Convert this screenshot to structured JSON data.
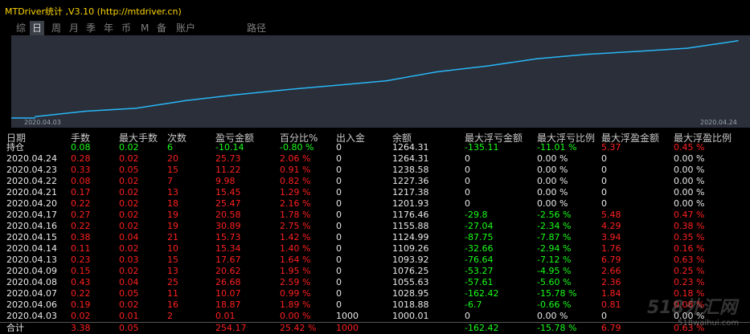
{
  "window_title": "MTDriver统计 ,V3.10 (http://mtdriver.cn)",
  "tabs": [
    "综",
    "日",
    "周",
    "月",
    "季",
    "年",
    "币",
    "M",
    "备",
    "账户",
    "路径"
  ],
  "chart": {
    "date_start": "2020.04.03",
    "date_end": "2020.04.24",
    "line_color": "#29b6f6"
  },
  "chart_data": {
    "type": "line",
    "x": [
      "2020.04.03",
      "2020.04.06",
      "2020.04.07",
      "2020.04.08",
      "2020.04.09",
      "2020.04.13",
      "2020.04.14",
      "2020.04.15",
      "2020.04.16",
      "2020.04.17",
      "2020.04.20",
      "2020.04.21",
      "2020.04.22",
      "2020.04.23",
      "2020.04.24"
    ],
    "values": [
      1000.01,
      1018.88,
      1028.95,
      1055.63,
      1076.25,
      1093.92,
      1109.26,
      1124.99,
      1155.88,
      1176.46,
      1201.93,
      1217.38,
      1227.36,
      1238.58,
      1264.31
    ]
  },
  "columns": [
    "日期",
    "手数",
    "最大手数",
    "次数",
    "盈亏金额",
    "百分比%",
    "出入金",
    "余额",
    "最大浮亏金额",
    "最大浮亏比例",
    "最大浮盈金额",
    "最大浮盈比例"
  ],
  "holding": {
    "date": "持仓",
    "lots": "0.08",
    "max_lots": "0.02",
    "count": "6",
    "pnl": "-10.14",
    "pct": "-0.80 %",
    "flow": "0",
    "balance": "1264.31",
    "max_loss": "-135.11",
    "max_loss_pct": "-11.01 %",
    "max_profit": "5.37",
    "max_profit_pct": "0.45 %"
  },
  "rows": [
    {
      "date": "2020.04.24",
      "lots": "0.28",
      "max_lots": "0.02",
      "count": "20",
      "pnl": "25.73",
      "pct": "2.06 %",
      "flow": "0",
      "balance": "1264.31",
      "max_loss": "0",
      "max_loss_pct": "0.00 %",
      "max_profit": "0",
      "max_profit_pct": "0.00 %"
    },
    {
      "date": "2020.04.23",
      "lots": "0.33",
      "max_lots": "0.05",
      "count": "15",
      "pnl": "11.22",
      "pct": "0.91 %",
      "flow": "0",
      "balance": "1238.58",
      "max_loss": "0",
      "max_loss_pct": "0.00 %",
      "max_profit": "0",
      "max_profit_pct": "0.00 %"
    },
    {
      "date": "2020.04.22",
      "lots": "0.08",
      "max_lots": "0.02",
      "count": "7",
      "pnl": "9.98",
      "pct": "0.82 %",
      "flow": "0",
      "balance": "1227.36",
      "max_loss": "0",
      "max_loss_pct": "0.00 %",
      "max_profit": "0",
      "max_profit_pct": "0.00 %"
    },
    {
      "date": "2020.04.21",
      "lots": "0.17",
      "max_lots": "0.02",
      "count": "13",
      "pnl": "15.45",
      "pct": "1.29 %",
      "flow": "0",
      "balance": "1217.38",
      "max_loss": "0",
      "max_loss_pct": "0.00 %",
      "max_profit": "0",
      "max_profit_pct": "0.00 %"
    },
    {
      "date": "2020.04.20",
      "lots": "0.22",
      "max_lots": "0.02",
      "count": "18",
      "pnl": "25.47",
      "pct": "2.16 %",
      "flow": "0",
      "balance": "1201.93",
      "max_loss": "0",
      "max_loss_pct": "0.00 %",
      "max_profit": "0",
      "max_profit_pct": "0.00 %"
    },
    {
      "date": "2020.04.17",
      "lots": "0.27",
      "max_lots": "0.02",
      "count": "19",
      "pnl": "20.58",
      "pct": "1.78 %",
      "flow": "0",
      "balance": "1176.46",
      "max_loss": "-29.8",
      "max_loss_pct": "-2.56 %",
      "max_profit": "5.48",
      "max_profit_pct": "0.47 %"
    },
    {
      "date": "2020.04.16",
      "lots": "0.22",
      "max_lots": "0.02",
      "count": "19",
      "pnl": "30.89",
      "pct": "2.75 %",
      "flow": "0",
      "balance": "1155.88",
      "max_loss": "-27.04",
      "max_loss_pct": "-2.34 %",
      "max_profit": "4.29",
      "max_profit_pct": "0.38 %"
    },
    {
      "date": "2020.04.15",
      "lots": "0.38",
      "max_lots": "0.04",
      "count": "21",
      "pnl": "15.73",
      "pct": "1.42 %",
      "flow": "0",
      "balance": "1124.99",
      "max_loss": "-87.75",
      "max_loss_pct": "-7.87 %",
      "max_profit": "3.94",
      "max_profit_pct": "0.35 %"
    },
    {
      "date": "2020.04.14",
      "lots": "0.11",
      "max_lots": "0.02",
      "count": "10",
      "pnl": "15.34",
      "pct": "1.40 %",
      "flow": "0",
      "balance": "1109.26",
      "max_loss": "-32.66",
      "max_loss_pct": "-2.94 %",
      "max_profit": "1.76",
      "max_profit_pct": "0.16 %"
    },
    {
      "date": "2020.04.13",
      "lots": "0.23",
      "max_lots": "0.03",
      "count": "15",
      "pnl": "17.67",
      "pct": "1.64 %",
      "flow": "0",
      "balance": "1093.92",
      "max_loss": "-76.64",
      "max_loss_pct": "-7.12 %",
      "max_profit": "6.79",
      "max_profit_pct": "0.63 %"
    },
    {
      "date": "2020.04.09",
      "lots": "0.15",
      "max_lots": "0.02",
      "count": "13",
      "pnl": "20.62",
      "pct": "1.95 %",
      "flow": "0",
      "balance": "1076.25",
      "max_loss": "-53.27",
      "max_loss_pct": "-4.95 %",
      "max_profit": "2.66",
      "max_profit_pct": "0.25 %"
    },
    {
      "date": "2020.04.08",
      "lots": "0.43",
      "max_lots": "0.04",
      "count": "25",
      "pnl": "26.68",
      "pct": "2.59 %",
      "flow": "0",
      "balance": "1055.63",
      "max_loss": "-57.61",
      "max_loss_pct": "-5.60 %",
      "max_profit": "2.36",
      "max_profit_pct": "0.23 %"
    },
    {
      "date": "2020.04.07",
      "lots": "0.22",
      "max_lots": "0.05",
      "count": "11",
      "pnl": "10.07",
      "pct": "0.99 %",
      "flow": "0",
      "balance": "1028.95",
      "max_loss": "-162.42",
      "max_loss_pct": "-15.78 %",
      "max_profit": "1.84",
      "max_profit_pct": "0.18 %"
    },
    {
      "date": "2020.04.06",
      "lots": "0.19",
      "max_lots": "0.02",
      "count": "16",
      "pnl": "18.87",
      "pct": "1.89 %",
      "flow": "0",
      "balance": "1018.88",
      "max_loss": "-6.7",
      "max_loss_pct": "-0.66 %",
      "max_profit": "0.81",
      "max_profit_pct": "0.08 %"
    },
    {
      "date": "2020.04.03",
      "lots": "0.02",
      "max_lots": "0.01",
      "count": "2",
      "pnl": "0.01",
      "pct": "0.00 %",
      "flow": "1000",
      "balance": "1000.01",
      "max_loss": "0",
      "max_loss_pct": "0.00 %",
      "max_profit": "0",
      "max_profit_pct": "0.00 %"
    }
  ],
  "total": {
    "date": "合计",
    "lots": "3.38",
    "max_lots": "0.05",
    "count": "",
    "pnl": "254.17",
    "pct": "25.42 %",
    "flow": "1000",
    "balance": "",
    "max_loss": "-162.42",
    "max_loss_pct": "-15.78 %",
    "max_profit": "6.79",
    "max_profit_pct": "0.63 %"
  },
  "watermark": {
    "logo": "518外汇网",
    "url": "518waihui.com"
  }
}
